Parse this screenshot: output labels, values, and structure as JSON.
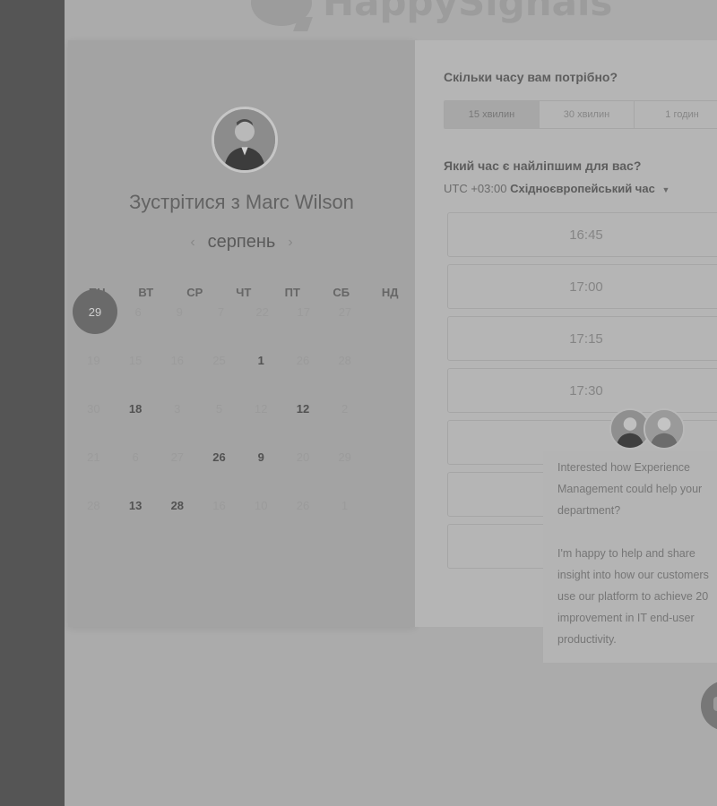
{
  "logo": {
    "text": "HappySignals"
  },
  "calendar": {
    "meet_label": "Зустрітися з Marc Wilson",
    "prev_arrow": "‹",
    "next_arrow": "›",
    "month": "серпень",
    "weekdays": [
      "ПН",
      "ВТ",
      "СР",
      "ЧТ",
      "ПТ",
      "СБ",
      "НД"
    ],
    "weeks": [
      [
        "29",
        "6",
        "9",
        "7",
        "22",
        "17",
        "27"
      ],
      [
        "19",
        "15",
        "16",
        "25",
        "1",
        "26",
        "28"
      ],
      [
        "30",
        "18",
        "3",
        "5",
        "12",
        "12",
        "2"
      ],
      [
        "21",
        "6",
        "27",
        "26",
        "9",
        "20",
        "29"
      ],
      [
        "28",
        "13",
        "28",
        "16",
        "10",
        "26",
        "1"
      ]
    ],
    "available": [
      [
        1,
        4
      ],
      [
        2,
        1
      ],
      [
        2,
        5
      ],
      [
        3,
        3
      ],
      [
        3,
        4
      ],
      [
        4,
        1
      ],
      [
        4,
        2
      ]
    ],
    "selected": [
      0,
      0
    ]
  },
  "booking": {
    "duration_question": "Скільки часу вам потрібно?",
    "durations": [
      "15 хвилин",
      "30 хвилин",
      "1 годин"
    ],
    "active_duration": 0,
    "time_question": "Який час є найліпшим для вас?",
    "timezone_prefix": "UTC +03:00",
    "timezone_name": "Східноєвропейський час",
    "slots": [
      "16:45",
      "17:00",
      "17:15",
      "17:30",
      "",
      "",
      ""
    ]
  },
  "chat": {
    "line1": "Interested how Experience",
    "line2": "Management could help your",
    "line3": "department?",
    "line4": "I'm happy to help and share",
    "line5": "insight into how our customers",
    "line6": "use our platform to achieve 20",
    "line7": "improvement in IT end-user",
    "line8": "productivity."
  }
}
